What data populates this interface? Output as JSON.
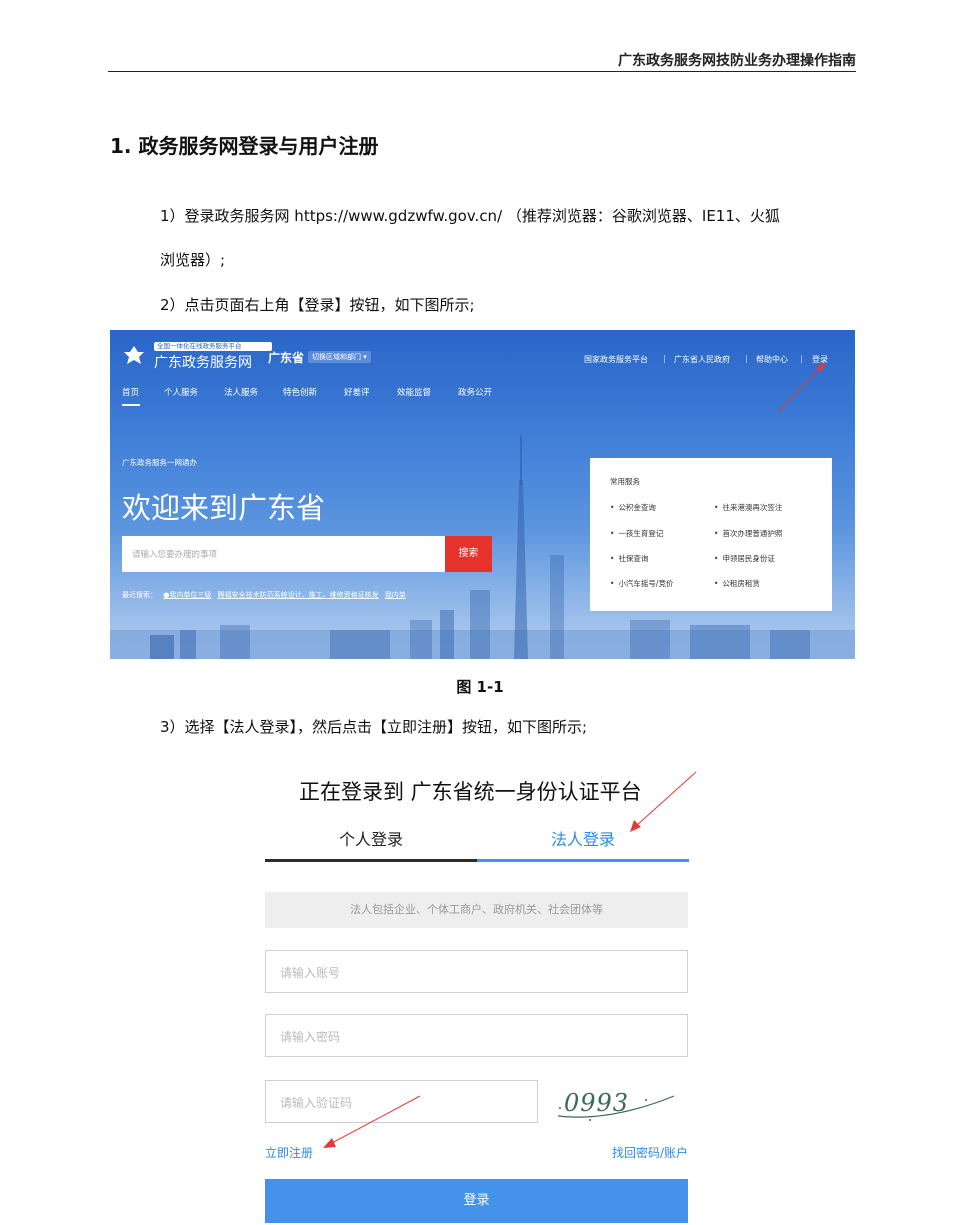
{
  "header": {
    "title": "广东政务服务网技防业务办理操作指南"
  },
  "section": {
    "title": "1. 政务服务网登录与用户注册"
  },
  "steps": {
    "step1_line1": "1）登录政务服务网 https://www.gdzwfw.gov.cn/ （推荐浏览器：谷歌浏览器、IE11、火狐",
    "step1_line2": "浏览器）;",
    "step2": "2）点击页面右上角【登录】按钮，如下图所示;",
    "step3": "3）选择【法人登录】，然后点击【立即注册】按钮，如下图所示;"
  },
  "figure1": {
    "caption": "图 1-1",
    "logo_sub": "全国一体化在线政务服务平台",
    "logo_main": "广东政务服务网",
    "province": "广东省",
    "dept_selector": "切换区域和部门 ▾",
    "top_links": [
      "国家政务服务平台",
      "广东省人民政府",
      "帮助中心",
      "登录"
    ],
    "nav": [
      "首页",
      "个人服务",
      "法人服务",
      "特色创新",
      "好差评",
      "效能监督",
      "政务公开"
    ],
    "tagline": "广东政务服务一网通办",
    "welcome": "欢迎来到广东省",
    "search_placeholder": "请输入您要办理的事项",
    "search_button": "搜索",
    "recent_label": "最近搜索：",
    "recent_items": [
      "●我内单位三级",
      "腾福安全技术防范系统设计、施工、维修资格证核发",
      "我内单"
    ],
    "services_title": "常用服务",
    "services": [
      "公积金查询",
      "往来港澳再次签注",
      "一孩生育登记",
      "首次办理普通护照",
      "社保查询",
      "申领居民身份证",
      "小汽车摇号/竞价",
      "公租房租赁"
    ]
  },
  "figure2": {
    "title": "正在登录到 广东省统一身份认证平台",
    "tab_personal": "个人登录",
    "tab_corporate": "法人登录",
    "info": "法人包括企业、个体工商户、政府机关、社会团体等",
    "account_placeholder": "请输入账号",
    "password_placeholder": "请输入密码",
    "captcha_placeholder": "请输入验证码",
    "captcha_text": "0993",
    "register_link": "立即注册",
    "recover_link": "找回密码/账户",
    "login_button": "登录"
  },
  "colors": {
    "primary_blue": "#2a66c8",
    "link_blue": "#2f8ae6",
    "search_red": "#e5322d",
    "arrow_red": "#e53935"
  }
}
